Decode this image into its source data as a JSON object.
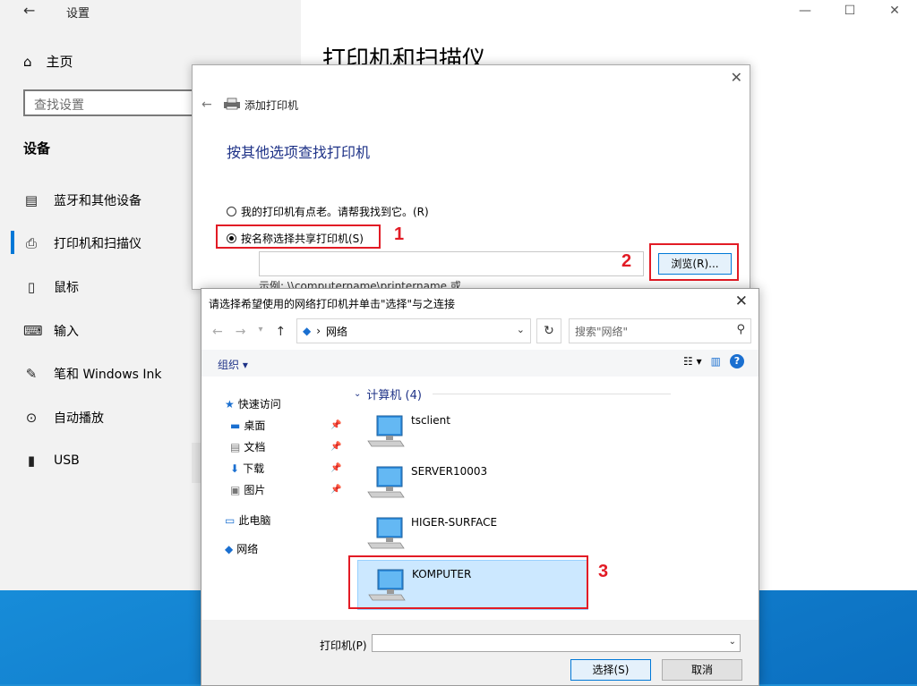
{
  "settings": {
    "title": "设置",
    "home": "主页",
    "search_placeholder": "查找设置",
    "section": "设备",
    "page_heading": "打印机和扫描仪",
    "nav": [
      {
        "label": "蓝牙和其他设备",
        "icon": "bluetooth-devices-icon"
      },
      {
        "label": "打印机和扫描仪",
        "icon": "printer-icon"
      },
      {
        "label": "鼠标",
        "icon": "mouse-icon"
      },
      {
        "label": "输入",
        "icon": "keyboard-icon"
      },
      {
        "label": "笔和 Windows Ink",
        "icon": "pen-icon"
      },
      {
        "label": "自动播放",
        "icon": "autoplay-icon"
      },
      {
        "label": "USB",
        "icon": "usb-icon"
      }
    ],
    "selected": "打印机和扫描仪"
  },
  "wizard": {
    "title": "添加打印机",
    "heading": "按其他选项查找打印机",
    "option_old": "我的打印机有点老。请帮我找到它。(R)",
    "option_shared": "按名称选择共享打印机(S)",
    "browse_label": "浏览(R)...",
    "example": "示例: \\\\computername\\printername 或"
  },
  "annotations": [
    "1",
    "2",
    "3"
  ],
  "browse_dialog": {
    "title": "请选择希望使用的网络打印机并单击\"选择\"与之连接",
    "address": "网络",
    "search_placeholder": "搜索\"网络\"",
    "organize": "组织 ▾",
    "tree": {
      "quick_access": "快速访问",
      "desktop": "桌面",
      "documents": "文档",
      "downloads": "下载",
      "pictures": "图片",
      "this_pc": "此电脑",
      "network": "网络"
    },
    "group_header": "计算机 (4)",
    "computers": [
      "tsclient",
      "SERVER10003",
      "HIGER-SURFACE",
      "KOMPUTER"
    ],
    "selected_computer": "KOMPUTER",
    "printer_label": "打印机(P)",
    "printer_value": "",
    "select_button": "选择(S)",
    "cancel_button": "取消"
  },
  "colors": {
    "accent": "#0078d7",
    "annotation": "#e21b25",
    "heading_blue": "#1e3287",
    "selection": "#cce8ff"
  }
}
